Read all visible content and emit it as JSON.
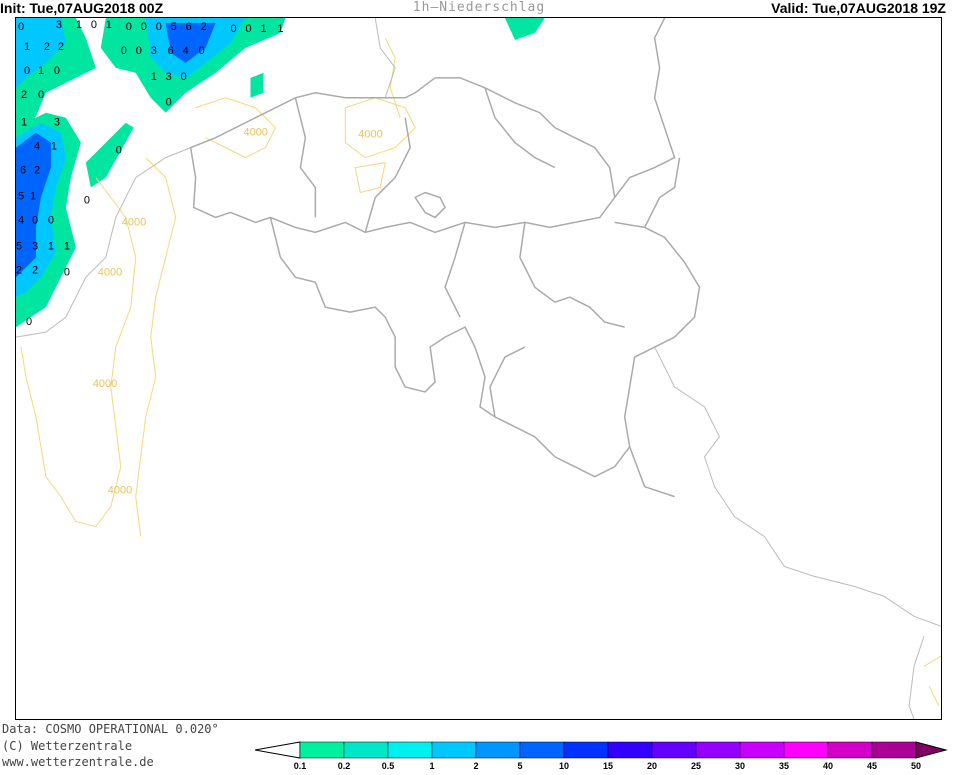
{
  "header": {
    "init": "Init: Tue,07AUG2018 00Z",
    "title": "1h—Niederschlag",
    "valid": "Valid: Tue,07AUG2018 19Z"
  },
  "footer": {
    "data": "Data: COSMO OPERATIONAL 0.020°",
    "copyright": "(C) Wetterzentrale",
    "url": "www.wetterzentrale.de"
  },
  "legend": {
    "ticks": [
      "0.1",
      "0.2",
      "0.5",
      "1",
      "2",
      "5",
      "10",
      "15",
      "20",
      "25",
      "30",
      "35",
      "40",
      "45",
      "50"
    ],
    "colors": [
      "#00f0a0",
      "#00e6c8",
      "#00f0f0",
      "#00c8ff",
      "#0096ff",
      "#0064ff",
      "#0032ff",
      "#3200ff",
      "#6400ff",
      "#9600ff",
      "#c800ff",
      "#ff00ff",
      "#d200c8",
      "#aa0096",
      "#800064"
    ]
  },
  "map": {
    "contour_label": "4000",
    "precip_labels": [
      "0",
      "3",
      "1",
      "0",
      "1",
      "0",
      "0",
      "0",
      "5",
      "6",
      "2",
      "0",
      "0",
      "1",
      "1",
      "2",
      "2",
      "0",
      "0",
      "3",
      "6",
      "4",
      "0",
      "1",
      "3",
      "0",
      "0",
      "1",
      "0",
      "2",
      "0",
      "1",
      "3",
      "4",
      "1",
      "6",
      "2",
      "5",
      "1",
      "4",
      "0",
      "0",
      "5",
      "3",
      "1",
      "1",
      "2",
      "0",
      "0"
    ]
  },
  "colors": {
    "border": "#aaaaaa",
    "contour": "#f5d77a",
    "precip_light": "#00e6a0",
    "precip_mid": "#00c8ff",
    "precip_dark": "#0064ff"
  }
}
